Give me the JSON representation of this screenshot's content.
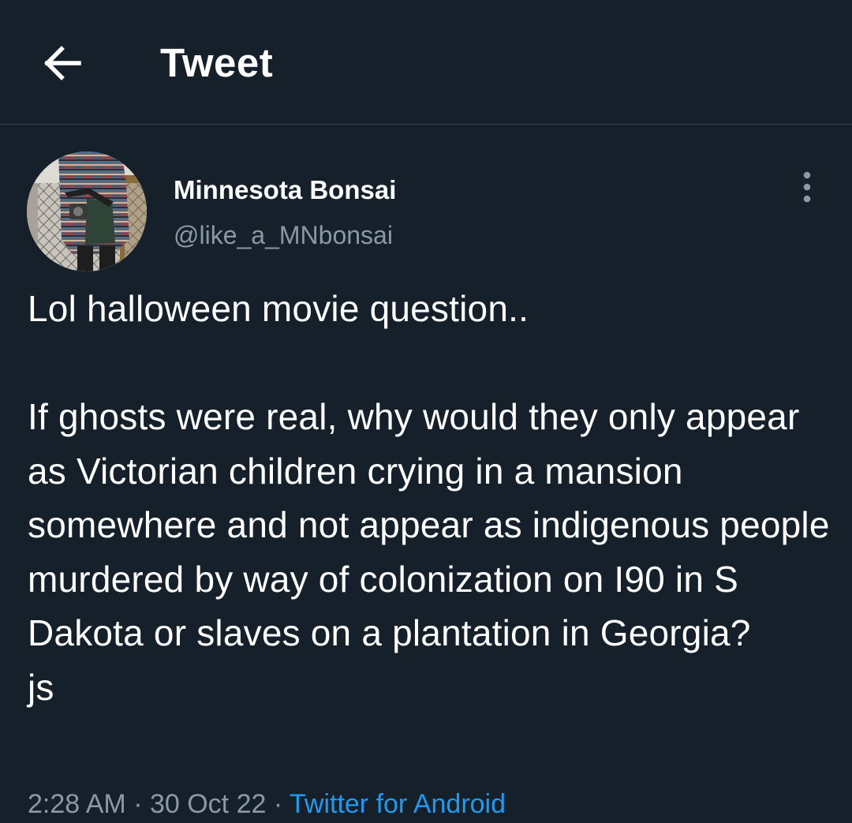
{
  "header": {
    "title": "Tweet",
    "back_icon": "arrow-left-icon"
  },
  "tweet": {
    "author": {
      "display_name": "Minnesota Bonsai",
      "handle": "@like_a_MNbonsai",
      "avatar": "avatar-photo"
    },
    "more_icon": "more-vertical-icon",
    "text": "Lol halloween movie question..\n\nIf ghosts were real, why would they only appear as Victorian children crying in a mansion somewhere and not appear as indigenous people murdered by way of colonization on I90 in S Dakota or slaves on a plantation in Georgia?\njs",
    "time": "2:28 AM",
    "separator": " · ",
    "date": "30 Oct 22",
    "source": "Twitter for Android"
  },
  "colors": {
    "background": "#15202b",
    "text": "#ffffff",
    "secondary_text": "#8b98a5",
    "link": "#1d9bf0",
    "divider": "#38444d"
  }
}
